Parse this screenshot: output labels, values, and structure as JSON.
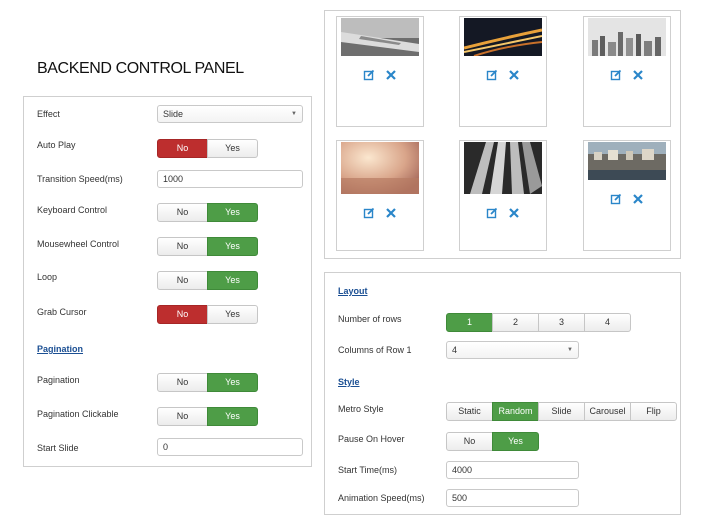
{
  "heading": "BACKEND CONTROL PANEL",
  "settings": {
    "effect": {
      "label": "Effect",
      "value": "Slide"
    },
    "auto_play": {
      "label": "Auto Play",
      "no": "No",
      "yes": "Yes",
      "selected": "No"
    },
    "transition_speed": {
      "label": "Transition Speed(ms)",
      "value": "1000"
    },
    "keyboard_control": {
      "label": "Keyboard Control",
      "no": "No",
      "yes": "Yes",
      "selected": "Yes"
    },
    "mousewheel_control": {
      "label": "Mousewheel Control",
      "no": "No",
      "yes": "Yes",
      "selected": "Yes"
    },
    "loop": {
      "label": "Loop",
      "no": "No",
      "yes": "Yes",
      "selected": "Yes"
    },
    "grab_cursor": {
      "label": "Grab Cursor",
      "no": "No",
      "yes": "Yes",
      "selected": "No"
    },
    "pagination_section": "Pagination",
    "pagination": {
      "label": "Pagination",
      "no": "No",
      "yes": "Yes",
      "selected": "Yes"
    },
    "pagination_clickable": {
      "label": "Pagination Clickable",
      "no": "No",
      "yes": "Yes",
      "selected": "Yes"
    },
    "start_slide": {
      "label": "Start Slide",
      "value": "0"
    }
  },
  "gallery": {
    "items": [
      {
        "image": "airplane-wing-bw",
        "edit_icon": "edit-icon",
        "delete_icon": "delete-icon"
      },
      {
        "image": "night-highway",
        "edit_icon": "edit-icon",
        "delete_icon": "delete-icon"
      },
      {
        "image": "city-skyline-bw",
        "edit_icon": "edit-icon",
        "delete_icon": "delete-icon"
      },
      {
        "image": "sunlit-garden",
        "edit_icon": "edit-icon",
        "delete_icon": "delete-icon"
      },
      {
        "image": "escalator-bw",
        "edit_icon": "edit-icon",
        "delete_icon": "delete-icon"
      },
      {
        "image": "harbor-town",
        "edit_icon": "edit-icon",
        "delete_icon": "delete-icon"
      }
    ]
  },
  "layout": {
    "section": "Layout",
    "rows": {
      "label": "Number of rows",
      "options": [
        "1",
        "2",
        "3",
        "4"
      ],
      "selected": "1"
    },
    "columns": {
      "label": "Columns of Row 1",
      "value": "4"
    },
    "style_section": "Style",
    "metro_style": {
      "label": "Metro Style",
      "options": [
        "Static",
        "Random",
        "Slide",
        "Carousel",
        "Flip"
      ],
      "selected": "Random"
    },
    "pause_on_hover": {
      "label": "Pause On Hover",
      "no": "No",
      "yes": "Yes",
      "selected": "Yes"
    },
    "start_time": {
      "label": "Start Time(ms)",
      "value": "4000"
    },
    "animation_speed": {
      "label": "Animation Speed(ms)",
      "value": "500"
    }
  },
  "colors": {
    "active_green": "#4e9d47",
    "active_red": "#bd2e2e",
    "section_blue": "#1b4f93",
    "icon_blue": "#2a86c9"
  }
}
